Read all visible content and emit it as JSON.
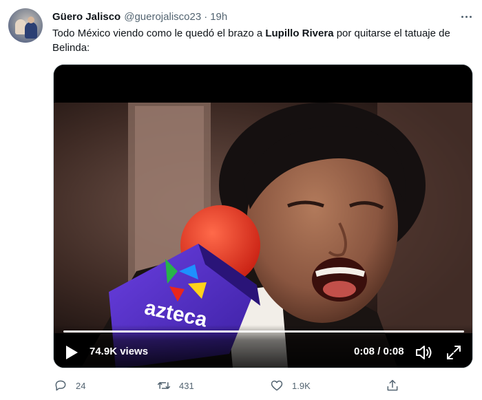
{
  "tweet": {
    "author": {
      "display_name": "Güero Jalisco",
      "handle": "@guerojalisco23",
      "separator": "·",
      "time": "19h",
      "avatar": "profile-photo"
    },
    "text": {
      "part1": "Todo México viendo como le quedó el brazo a ",
      "bold": "Lupillo Rivera",
      "part2": " por quitarse el tatuaje de Belinda:"
    },
    "video": {
      "views": "74.9K views",
      "timecode": "0:08 / 0:08",
      "progress": 1.0,
      "mic_logo_text": "azteca",
      "icons": {
        "play": "play-icon",
        "volume": "volume-icon",
        "fullscreen": "fullscreen-icon"
      }
    },
    "actions": {
      "replies": "24",
      "retweets": "431",
      "likes": "1.9K",
      "icons": [
        "reply-icon",
        "retweet-icon",
        "like-icon",
        "share-icon"
      ]
    },
    "colors": {
      "text": "#0f1419",
      "secondary": "#536471"
    }
  }
}
